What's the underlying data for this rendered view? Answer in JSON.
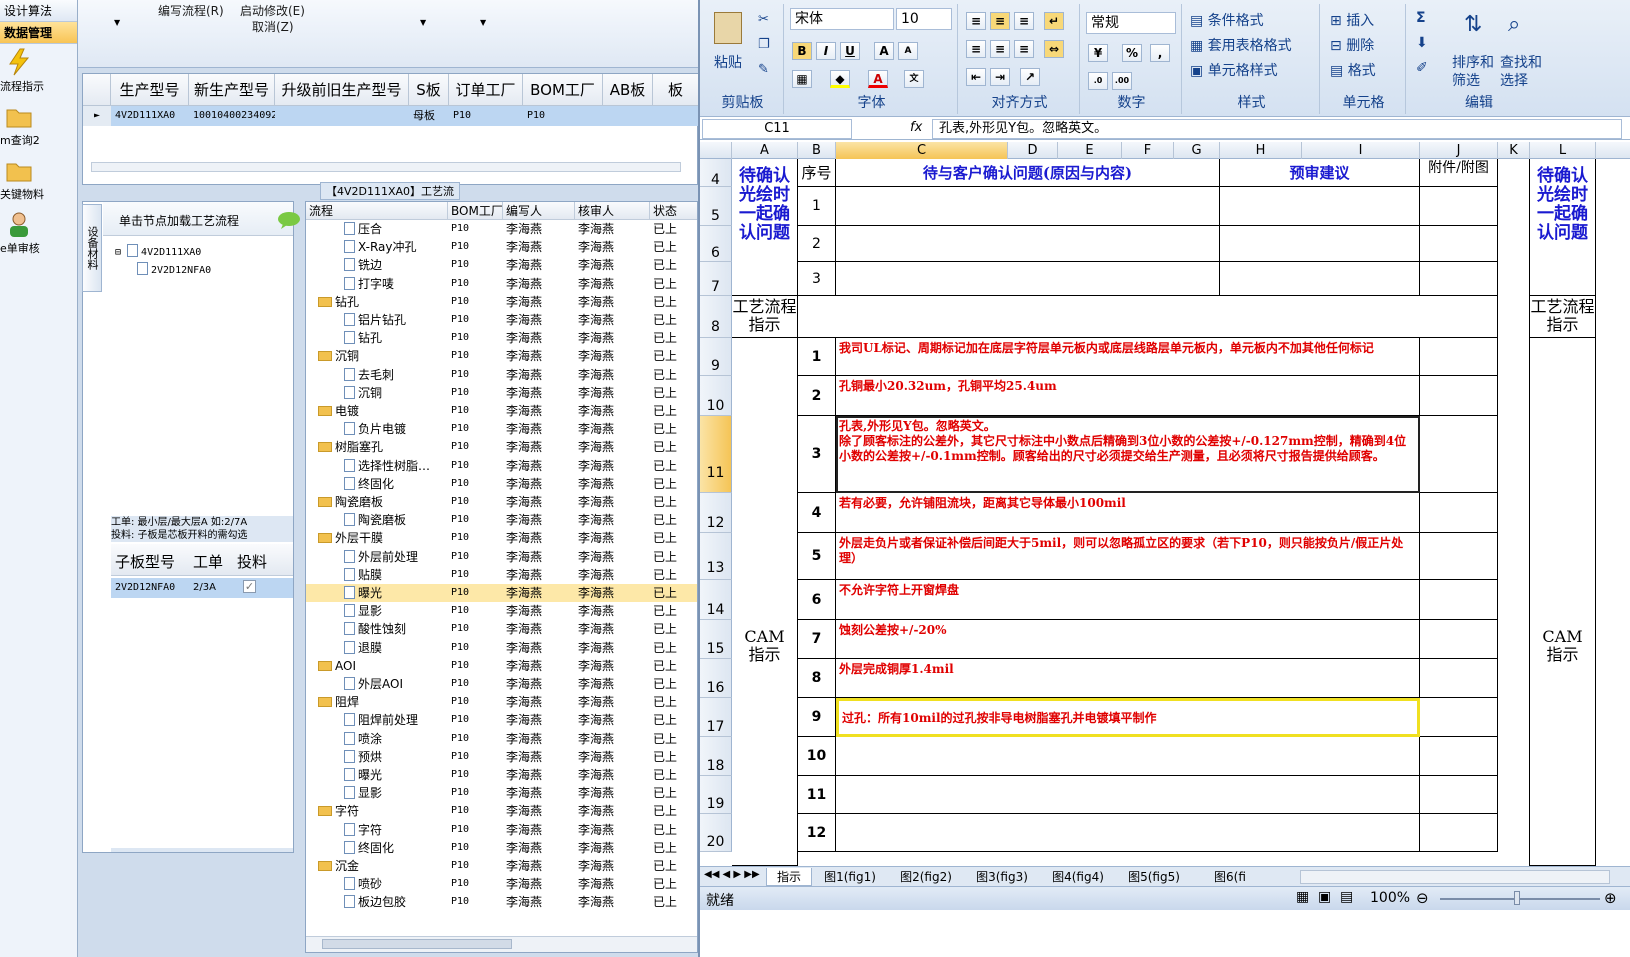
{
  "nav": {
    "items": [
      {
        "label": "设计算法",
        "selected": false
      },
      {
        "label": "数据管理",
        "selected": true
      },
      {
        "label": "流程指示",
        "icon": "lightning-icon"
      },
      {
        "label": "m查询2",
        "icon": "folder-icon"
      },
      {
        "label": "关键物料",
        "icon": "folder-icon"
      },
      {
        "label": "e单审核",
        "icon": "user-icon"
      }
    ]
  },
  "apptop": {
    "write_flow": "编写流程(R)",
    "start_edit": "启动修改(E)",
    "cancel": "取消(Z)"
  },
  "product_grid": {
    "headers": [
      "生产型号",
      "新生产型号",
      "升级前旧生产型号",
      "S板",
      "订单工厂",
      "BOM工厂",
      "AB板",
      "板"
    ],
    "row": [
      "4V2D111XA0",
      "10010400234092",
      "",
      "母板",
      "P10",
      "P10",
      "",
      ""
    ]
  },
  "process_title": "【4V2D111XA0】工艺流程",
  "left_panel": {
    "side_tab": "设备材料",
    "hint": "单击节点加载工艺流程",
    "tree": [
      "4V2D111XA0",
      "2V2D12NFA0"
    ],
    "note1": "工单: 最小层/最大层A 如:2/7A",
    "note2": "投料: 子板是芯板开料的需勾选",
    "sub_headers": [
      "子板型号",
      "工单",
      "投料"
    ],
    "sub_row": [
      "2V2D12NFA0",
      "2/3A",
      "✓"
    ]
  },
  "flow_table": {
    "headers": [
      "流程",
      "BOM工厂",
      "编写人",
      "核审人",
      "状态"
    ],
    "rows": [
      {
        "name": "压合",
        "type": "doc",
        "level": 2,
        "bom": "P10",
        "writer": "李海燕",
        "reviewer": "李海燕",
        "status": "已上"
      },
      {
        "name": "X-Ray冲孔",
        "type": "doc",
        "level": 2,
        "bom": "P10",
        "writer": "李海燕",
        "reviewer": "李海燕",
        "status": "已上"
      },
      {
        "name": "铣边",
        "type": "doc",
        "level": 2,
        "bom": "P10",
        "writer": "李海燕",
        "reviewer": "李海燕",
        "status": "已上"
      },
      {
        "name": "打字唛",
        "type": "doc",
        "level": 2,
        "bom": "P10",
        "writer": "李海燕",
        "reviewer": "李海燕",
        "status": "已上"
      },
      {
        "name": "钻孔",
        "type": "folder",
        "level": 1,
        "bom": "P10",
        "writer": "李海燕",
        "reviewer": "李海燕",
        "status": "已上"
      },
      {
        "name": "铝片钻孔",
        "type": "doc",
        "level": 2,
        "bom": "P10",
        "writer": "李海燕",
        "reviewer": "李海燕",
        "status": "已上"
      },
      {
        "name": "钻孔",
        "type": "doc",
        "level": 2,
        "bom": "P10",
        "writer": "李海燕",
        "reviewer": "李海燕",
        "status": "已上"
      },
      {
        "name": "沉铜",
        "type": "folder",
        "level": 1,
        "bom": "P10",
        "writer": "李海燕",
        "reviewer": "李海燕",
        "status": "已上"
      },
      {
        "name": "去毛刺",
        "type": "doc",
        "level": 2,
        "bom": "P10",
        "writer": "李海燕",
        "reviewer": "李海燕",
        "status": "已上"
      },
      {
        "name": "沉铜",
        "type": "doc",
        "level": 2,
        "bom": "P10",
        "writer": "李海燕",
        "reviewer": "李海燕",
        "status": "已上"
      },
      {
        "name": "电镀",
        "type": "folder",
        "level": 1,
        "bom": "P10",
        "writer": "李海燕",
        "reviewer": "李海燕",
        "status": "已上"
      },
      {
        "name": "负片电镀",
        "type": "doc",
        "level": 2,
        "bom": "P10",
        "writer": "李海燕",
        "reviewer": "李海燕",
        "status": "已上"
      },
      {
        "name": "树脂塞孔",
        "type": "folder",
        "level": 1,
        "bom": "P10",
        "writer": "李海燕",
        "reviewer": "李海燕",
        "status": "已上"
      },
      {
        "name": "选择性树脂…",
        "type": "doc",
        "level": 2,
        "bom": "P10",
        "writer": "李海燕",
        "reviewer": "李海燕",
        "status": "已上"
      },
      {
        "name": "终固化",
        "type": "doc",
        "level": 2,
        "bom": "P10",
        "writer": "李海燕",
        "reviewer": "李海燕",
        "status": "已上"
      },
      {
        "name": "陶瓷磨板",
        "type": "folder",
        "level": 1,
        "bom": "P10",
        "writer": "李海燕",
        "reviewer": "李海燕",
        "status": "已上"
      },
      {
        "name": "陶瓷磨板",
        "type": "doc",
        "level": 2,
        "bom": "P10",
        "writer": "李海燕",
        "reviewer": "李海燕",
        "status": "已上"
      },
      {
        "name": "外层干膜",
        "type": "folder",
        "level": 1,
        "bom": "P10",
        "writer": "李海燕",
        "reviewer": "李海燕",
        "status": "已上"
      },
      {
        "name": "外层前处理",
        "type": "doc",
        "level": 2,
        "bom": "P10",
        "writer": "李海燕",
        "reviewer": "李海燕",
        "status": "已上"
      },
      {
        "name": "贴膜",
        "type": "doc",
        "level": 2,
        "bom": "P10",
        "writer": "李海燕",
        "reviewer": "李海燕",
        "status": "已上"
      },
      {
        "name": "曝光",
        "type": "doc",
        "level": 2,
        "bom": "P10",
        "writer": "李海燕",
        "reviewer": "李海燕",
        "status": "已上",
        "selected": true
      },
      {
        "name": "显影",
        "type": "doc",
        "level": 2,
        "bom": "P10",
        "writer": "李海燕",
        "reviewer": "李海燕",
        "status": "已上"
      },
      {
        "name": "酸性蚀刻",
        "type": "doc",
        "level": 2,
        "bom": "P10",
        "writer": "李海燕",
        "reviewer": "李海燕",
        "status": "已上"
      },
      {
        "name": "退膜",
        "type": "doc",
        "level": 2,
        "bom": "P10",
        "writer": "李海燕",
        "reviewer": "李海燕",
        "status": "已上"
      },
      {
        "name": "AOI",
        "type": "folder",
        "level": 1,
        "bom": "P10",
        "writer": "李海燕",
        "reviewer": "李海燕",
        "status": "已上"
      },
      {
        "name": "外层AOI",
        "type": "doc",
        "level": 2,
        "bom": "P10",
        "writer": "李海燕",
        "reviewer": "李海燕",
        "status": "已上"
      },
      {
        "name": "阻焊",
        "type": "folder",
        "level": 1,
        "bom": "P10",
        "writer": "李海燕",
        "reviewer": "李海燕",
        "status": "已上"
      },
      {
        "name": "阻焊前处理",
        "type": "doc",
        "level": 2,
        "bom": "P10",
        "writer": "李海燕",
        "reviewer": "李海燕",
        "status": "已上"
      },
      {
        "name": "喷涂",
        "type": "doc",
        "level": 2,
        "bom": "P10",
        "writer": "李海燕",
        "reviewer": "李海燕",
        "status": "已上"
      },
      {
        "name": "预烘",
        "type": "doc",
        "level": 2,
        "bom": "P10",
        "writer": "李海燕",
        "reviewer": "李海燕",
        "status": "已上"
      },
      {
        "name": "曝光",
        "type": "doc",
        "level": 2,
        "bom": "P10",
        "writer": "李海燕",
        "reviewer": "李海燕",
        "status": "已上"
      },
      {
        "name": "显影",
        "type": "doc",
        "level": 2,
        "bom": "P10",
        "writer": "李海燕",
        "reviewer": "李海燕",
        "status": "已上"
      },
      {
        "name": "字符",
        "type": "folder",
        "level": 1,
        "bom": "P10",
        "writer": "李海燕",
        "reviewer": "李海燕",
        "status": "已上"
      },
      {
        "name": "字符",
        "type": "doc",
        "level": 2,
        "bom": "P10",
        "writer": "李海燕",
        "reviewer": "李海燕",
        "status": "已上"
      },
      {
        "name": "终固化",
        "type": "doc",
        "level": 2,
        "bom": "P10",
        "writer": "李海燕",
        "reviewer": "李海燕",
        "status": "已上"
      },
      {
        "name": "沉金",
        "type": "folder",
        "level": 1,
        "bom": "P10",
        "writer": "李海燕",
        "reviewer": "李海燕",
        "status": "已上"
      },
      {
        "name": "喷砂",
        "type": "doc",
        "level": 2,
        "bom": "P10",
        "writer": "李海燕",
        "reviewer": "李海燕",
        "status": "已上"
      },
      {
        "name": "板边包胶",
        "type": "doc",
        "level": 2,
        "bom": "P10",
        "writer": "李海燕",
        "reviewer": "李海燕",
        "status": "已上"
      }
    ]
  },
  "excel": {
    "ribbon": {
      "clipboard": {
        "paste": "粘贴",
        "title": "剪贴板"
      },
      "font": {
        "name": "宋体",
        "size": "10",
        "title": "字体"
      },
      "align": {
        "title": "对齐方式"
      },
      "number": {
        "format": "常规",
        "title": "数字"
      },
      "styles": {
        "cond": "条件格式",
        "table": "套用表格格式",
        "cell": "单元格样式",
        "title": "样式"
      },
      "cells": {
        "insert": "插入",
        "delete": "删除",
        "format": "格式",
        "title": "单元格"
      },
      "edit": {
        "sort": "排序和\n筛选",
        "find": "查找和\n选择",
        "title": "编辑"
      }
    },
    "name_box": "C11",
    "formula": "孔表,外形见Y包。忽略英文。",
    "columns": [
      "A",
      "B",
      "C",
      "D",
      "E",
      "F",
      "G",
      "H",
      "I",
      "J",
      "K",
      "L"
    ],
    "active_col": "C",
    "active_row": "11",
    "header_row": {
      "seq": "序号",
      "question": "待与客户确认问题(原因与内容)",
      "advice": "预审建议",
      "attach": "附件/附图"
    },
    "confirm_label": "待确认\n光绘时\n一起确\n认问题",
    "flow_label": "工艺流程\n指示",
    "cam_label": "CAM\n指示",
    "cam_items": [
      {
        "n": "1",
        "text": "我司UL标记、周期标记加在底层字符层单元板内或底层线路层单元板内，单元板内不加其他任何标记"
      },
      {
        "n": "2",
        "text": "孔铜最小20.32um，孔铜平均25.4um"
      },
      {
        "n": "3",
        "text": "孔表,外形见Y包。忽略英文。\n除了顾客标注的公差外，其它尺寸标注中小数点后精确到3位小数的公差按+/-0.127mm控制，精确到4位小数的公差按+/-0.1mm控制。顾客给出的尺寸必须提交给生产测量，且必须将尺寸报告提供给顾客。"
      },
      {
        "n": "4",
        "text": "若有必要，允许铺阻流块，距离其它导体最小100mil"
      },
      {
        "n": "5",
        "text": "外层走负片或者保证补偿后间距大于5mil，则可以忽略孤立区的要求（若下P10，则只能按负片/假正片处理）"
      },
      {
        "n": "6",
        "text": "不允许字符上开窗焊盘"
      },
      {
        "n": "7",
        "text": "蚀刻公差按+/-20%"
      },
      {
        "n": "8",
        "text": "外层完成铜厚1.4mil"
      },
      {
        "n": "9",
        "text": "过孔：所有10mil的过孔按非导电树脂塞孔并电镀填平制作"
      },
      {
        "n": "10",
        "text": ""
      },
      {
        "n": "11",
        "text": ""
      },
      {
        "n": "12",
        "text": ""
      }
    ],
    "rows": [
      "4",
      "5",
      "6",
      "7",
      "8",
      "9",
      "10",
      "11",
      "12",
      "13",
      "14",
      "15",
      "16",
      "17",
      "18",
      "19",
      "20"
    ],
    "sheet_tabs": [
      "指示",
      "图1(fig1)",
      "图2(fig2)",
      "图3(fig3)",
      "图4(fig4)",
      "图5(fig5)",
      "图6(fi"
    ],
    "status": "就绪",
    "zoom": "100%"
  }
}
